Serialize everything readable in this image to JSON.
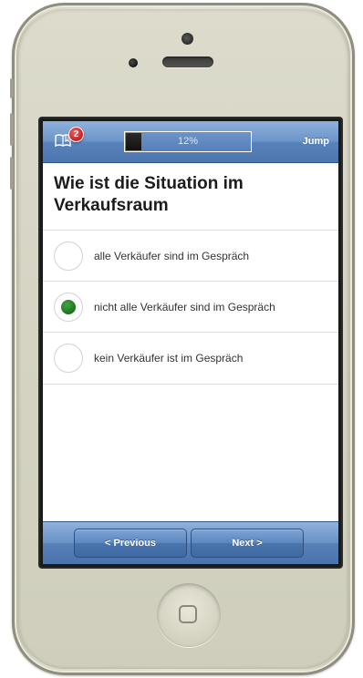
{
  "navbar": {
    "badge_count": "2",
    "progress_text": "12%",
    "progress_value": 0.12,
    "jump_label": "Jump",
    "bookmark_icon": "bookmark-book-icon"
  },
  "question": {
    "title": "Wie ist die Situation im Verkaufsraum"
  },
  "options": [
    {
      "label": "alle Verkäufer sind im Gespräch",
      "selected": false
    },
    {
      "label": "nicht alle Verkäufer sind im Gespräch",
      "selected": true
    },
    {
      "label": "kein Verkäufer ist im Gespräch",
      "selected": false
    }
  ],
  "toolbar": {
    "previous_label": "< Previous",
    "next_label": "Next >"
  },
  "colors": {
    "bar_blue": "#5882ba",
    "selected_green": "#2e8b2e",
    "badge_red": "#d32626"
  }
}
